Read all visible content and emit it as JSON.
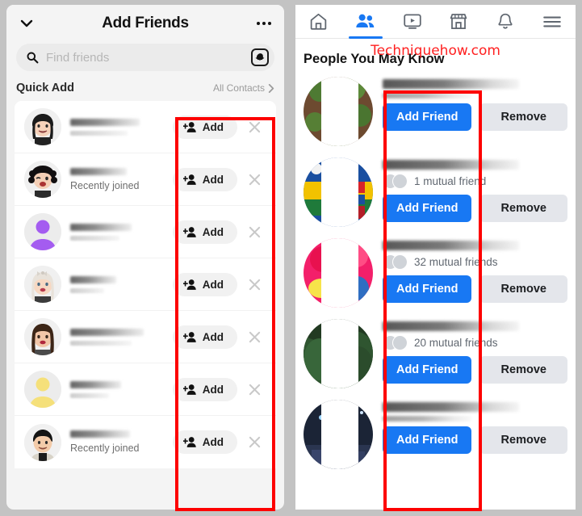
{
  "left_panel": {
    "app": "snapchat-add-friends",
    "header": {
      "title": "Add Friends",
      "back_icon": "chevron-down-icon",
      "more_icon": "more-options-icon"
    },
    "search": {
      "placeholder": "Find friends",
      "icon": "search-icon",
      "trailing_icon": "snapchat-ghost-icon"
    },
    "section": {
      "label": "Quick Add",
      "link": "All Contacts",
      "link_icon": "chevron-right-icon"
    },
    "rows": [
      {
        "name_redacted": true,
        "subnote": "",
        "action": "Add",
        "action_icon": "add-person-icon",
        "dismiss_icon": "close-icon",
        "avatar": "bitmoji-dark-hair-smile"
      },
      {
        "name_redacted": true,
        "subnote": "Recently joined",
        "action": "Add",
        "action_icon": "add-person-icon",
        "dismiss_icon": "close-icon",
        "avatar": "bitmoji-curly-wink"
      },
      {
        "name_redacted": true,
        "subnote": "",
        "action": "Add",
        "action_icon": "add-person-icon",
        "dismiss_icon": "close-icon",
        "avatar": "default-purple-silhouette"
      },
      {
        "name_redacted": true,
        "subnote": "",
        "action": "Add",
        "action_icon": "add-person-icon",
        "dismiss_icon": "close-icon",
        "avatar": "bitmoji-blonde-bow"
      },
      {
        "name_redacted": true,
        "subnote": "",
        "action": "Add",
        "action_icon": "add-person-icon",
        "dismiss_icon": "close-icon",
        "avatar": "bitmoji-long-brown-hair"
      },
      {
        "name_redacted": true,
        "subnote": "",
        "action": "Add",
        "action_icon": "add-person-icon",
        "dismiss_icon": "close-icon",
        "avatar": "default-yellow-silhouette"
      },
      {
        "name_redacted": true,
        "subnote": "Recently joined",
        "action": "Add",
        "action_icon": "add-person-icon",
        "dismiss_icon": "close-icon",
        "avatar": "bitmoji-male-black-hair"
      }
    ]
  },
  "right_panel": {
    "app": "facebook-people-you-may-know",
    "nav": [
      {
        "name": "home-icon",
        "label": "Home",
        "active": false
      },
      {
        "name": "friends-icon",
        "label": "Friends",
        "active": true
      },
      {
        "name": "watch-icon",
        "label": "Watch",
        "active": false
      },
      {
        "name": "marketplace-icon",
        "label": "Marketplace",
        "active": false
      },
      {
        "name": "notifications-bell-icon",
        "label": "Notifications",
        "active": false
      },
      {
        "name": "hamburger-menu-icon",
        "label": "Menu",
        "active": false
      }
    ],
    "watermark": "Techniquehow.com",
    "section_title": "People You May Know",
    "cards": [
      {
        "name_redacted": true,
        "mutual": "",
        "add_label": "Add Friend",
        "remove_label": "Remove",
        "photo": "plant-soil-photo"
      },
      {
        "name_redacted": true,
        "mutual": "1 mutual friend",
        "add_label": "Add Friend",
        "remove_label": "Remove",
        "photo": "flag-colorful-photo"
      },
      {
        "name_redacted": true,
        "mutual": "32 mutual friends",
        "add_label": "Add Friend",
        "remove_label": "Remove",
        "photo": "pink-flower-photo"
      },
      {
        "name_redacted": true,
        "mutual": "20 mutual friends",
        "add_label": "Add Friend",
        "remove_label": "Remove",
        "photo": "dark-green-leaf-photo"
      },
      {
        "name_redacted": true,
        "mutual": "",
        "add_label": "Add Friend",
        "remove_label": "Remove",
        "photo": "night-city-photo"
      }
    ]
  },
  "annotations": {
    "left_box": "highlight-add-buttons-column",
    "right_box": "highlight-add-friend-buttons-column",
    "color": "#fd0000"
  },
  "colors": {
    "facebook_blue": "#1878f3",
    "remove_gray": "#e4e6eb",
    "annotation_red": "#fd0000",
    "watermark_red": "#ff2020",
    "snap_bg": "#f4f4f4"
  }
}
